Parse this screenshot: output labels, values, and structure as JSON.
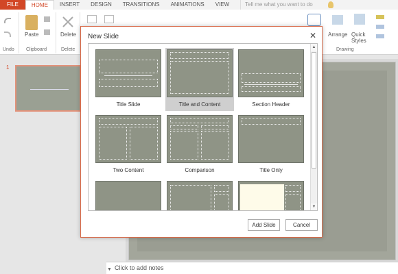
{
  "ribbon": {
    "tabs": [
      "FILE",
      "HOME",
      "INSERT",
      "DESIGN",
      "TRANSITIONS",
      "ANIMATIONS",
      "VIEW"
    ],
    "tell_me": "Tell me what you want to do",
    "groups": {
      "undo": "Undo",
      "clipboard": "Clipboard",
      "delete": "Delete",
      "drawing": "Drawing"
    },
    "buttons": {
      "paste": "Paste",
      "delete": "Delete",
      "arrange": "Arrange",
      "quick_styles": "Quick Styles"
    }
  },
  "slide_panel": {
    "slide_number": "1"
  },
  "notes": {
    "placeholder": "Click to add notes"
  },
  "dialog": {
    "title": "New Slide",
    "layouts": [
      "Title Slide",
      "Title and Content",
      "Section Header",
      "Two Content",
      "Comparison",
      "Title Only"
    ],
    "selected_layout": "Title and Content",
    "add_button": "Add Slide",
    "cancel_button": "Cancel"
  }
}
